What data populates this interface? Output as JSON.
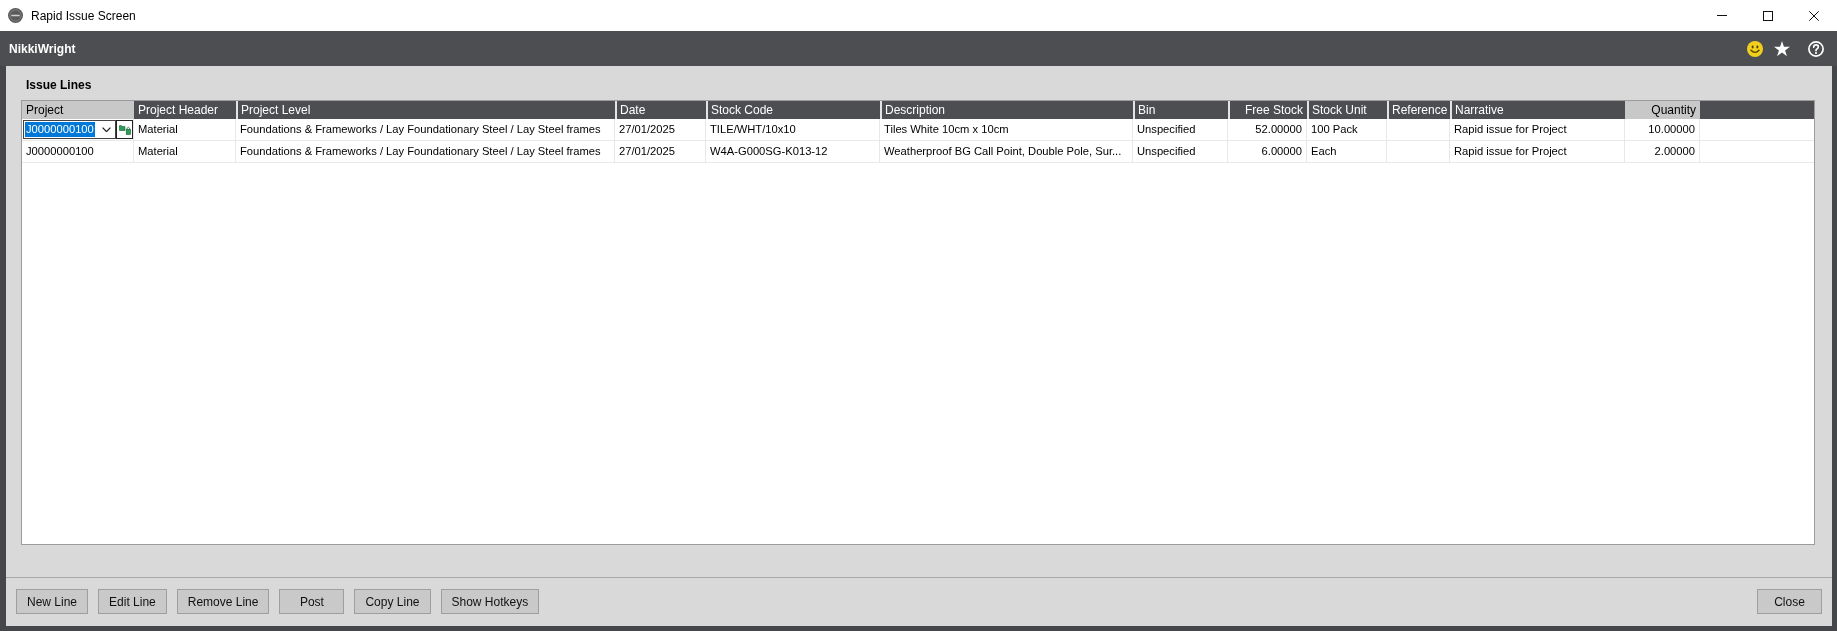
{
  "window": {
    "title": "Rapid Issue Screen"
  },
  "header": {
    "user": "NikkiWright"
  },
  "issue_lines": {
    "title": "Issue Lines",
    "columns": [
      {
        "label": "Project",
        "kind": "text",
        "highlighted": true
      },
      {
        "label": "Project Header",
        "kind": "text",
        "highlighted": false
      },
      {
        "label": "Project Level",
        "kind": "text",
        "highlighted": false
      },
      {
        "label": "Date",
        "kind": "text",
        "highlighted": false
      },
      {
        "label": "Stock Code",
        "kind": "text",
        "highlighted": false
      },
      {
        "label": "Description",
        "kind": "text",
        "highlighted": false
      },
      {
        "label": "Bin",
        "kind": "text",
        "highlighted": false
      },
      {
        "label": "Free Stock",
        "kind": "number",
        "highlighted": false
      },
      {
        "label": "Stock Unit",
        "kind": "text",
        "highlighted": false
      },
      {
        "label": "Reference",
        "kind": "text",
        "highlighted": false
      },
      {
        "label": "Narrative",
        "kind": "text",
        "highlighted": false
      },
      {
        "label": "Quantity",
        "kind": "number",
        "highlighted": true
      }
    ],
    "rows": [
      {
        "editing": true,
        "project": "J0000000100",
        "project_header": "Material",
        "project_level": "Foundations & Frameworks / Lay Foundationary Steel / Lay Steel frames",
        "date": "27/01/2025",
        "stock_code": "TILE/WHT/10x10",
        "description": "Tiles White 10cm x 10cm",
        "bin": "Unspecified",
        "free_stock": "52.00000",
        "stock_unit": "100 Pack",
        "narrative": "Rapid issue for Project",
        "quantity": "10.00000"
      },
      {
        "editing": false,
        "project": "J0000000100",
        "project_header": "Material",
        "project_level": "Foundations & Frameworks / Lay Foundationary Steel / Lay Steel frames",
        "date": "27/01/2025",
        "stock_code": "W4A-G000SG-K013-12",
        "description": "Weatherproof BG Call Point, Double Pole, Sur...",
        "bin": "Unspecified",
        "free_stock": "6.00000",
        "stock_unit": "Each",
        "narrative": "Rapid issue for Project",
        "quantity": "2.00000"
      }
    ]
  },
  "buttons": [
    "New Line",
    "Edit Line",
    "Remove Line",
    "Post",
    "Copy Line",
    "Show Hotkeys"
  ],
  "close_button": "Close"
}
